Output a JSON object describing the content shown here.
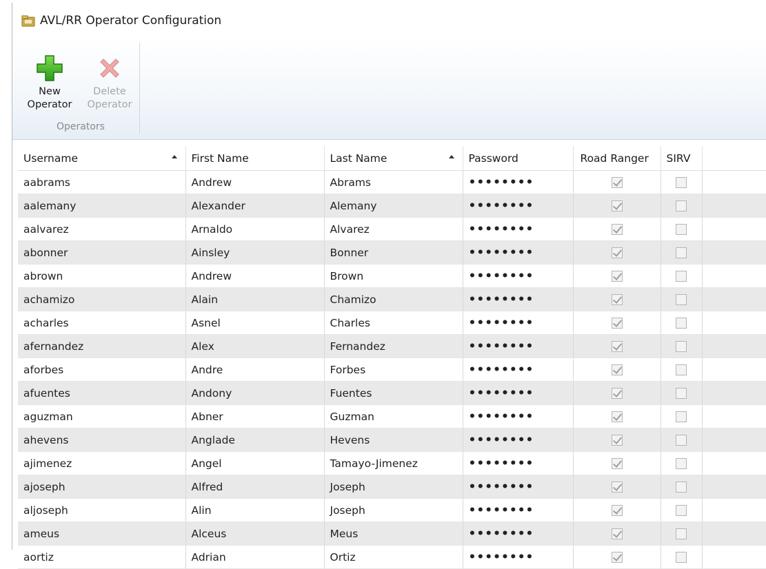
{
  "window": {
    "title": "AVL/RR Operator Configuration",
    "app_icon": "app-folder-icon"
  },
  "ribbon": {
    "new_operator": {
      "line1": "New",
      "line2": "Operator",
      "icon": "plus-icon"
    },
    "delete_operator": {
      "line1": "Delete",
      "line2": "Operator",
      "icon": "delete-x-icon"
    },
    "group_label": "Operators"
  },
  "grid": {
    "columns": [
      "Username",
      "First Name",
      "Last Name",
      "Password",
      "Road Ranger",
      "SIRV"
    ],
    "sorted_columns": [
      "Username",
      "Last Name"
    ],
    "rows": [
      {
        "username": "aabrams",
        "first": "Andrew",
        "last": "Abrams",
        "password": "••••••••",
        "road_ranger": true,
        "sirv": false
      },
      {
        "username": "aalemany",
        "first": "Alexander",
        "last": "Alemany",
        "password": "••••••••",
        "road_ranger": true,
        "sirv": false
      },
      {
        "username": "aalvarez",
        "first": "Arnaldo",
        "last": "Alvarez",
        "password": "••••••••",
        "road_ranger": true,
        "sirv": false
      },
      {
        "username": "abonner",
        "first": "Ainsley",
        "last": "Bonner",
        "password": "••••••••",
        "road_ranger": true,
        "sirv": false
      },
      {
        "username": "abrown",
        "first": "Andrew",
        "last": "Brown",
        "password": "••••••••",
        "road_ranger": true,
        "sirv": false
      },
      {
        "username": "achamizo",
        "first": "Alain",
        "last": "Chamizo",
        "password": "••••••••",
        "road_ranger": true,
        "sirv": false
      },
      {
        "username": "acharles",
        "first": "Asnel",
        "last": "Charles",
        "password": "••••••••",
        "road_ranger": true,
        "sirv": false
      },
      {
        "username": "afernandez",
        "first": "Alex",
        "last": "Fernandez",
        "password": "••••••••",
        "road_ranger": true,
        "sirv": false
      },
      {
        "username": "aforbes",
        "first": "Andre",
        "last": "Forbes",
        "password": "••••••••",
        "road_ranger": true,
        "sirv": false
      },
      {
        "username": "afuentes",
        "first": "Andony",
        "last": "Fuentes",
        "password": "••••••••",
        "road_ranger": true,
        "sirv": false
      },
      {
        "username": "aguzman",
        "first": "Abner",
        "last": "Guzman",
        "password": "••••••••",
        "road_ranger": true,
        "sirv": false
      },
      {
        "username": "ahevens",
        "first": "Anglade",
        "last": "Hevens",
        "password": "••••••••",
        "road_ranger": true,
        "sirv": false
      },
      {
        "username": "ajimenez",
        "first": "Angel",
        "last": "Tamayo-Jimenez",
        "password": "••••••••",
        "road_ranger": true,
        "sirv": false
      },
      {
        "username": "ajoseph",
        "first": "Alfred",
        "last": "Joseph",
        "password": "••••••••",
        "road_ranger": true,
        "sirv": false
      },
      {
        "username": "aljoseph",
        "first": "Alin",
        "last": "Joseph",
        "password": "••••••••",
        "road_ranger": true,
        "sirv": false
      },
      {
        "username": "ameus",
        "first": "Alceus",
        "last": "Meus",
        "password": "••••••••",
        "road_ranger": true,
        "sirv": false
      },
      {
        "username": "aortiz",
        "first": "Adrian",
        "last": "Ortiz",
        "password": "••••••••",
        "road_ranger": true,
        "sirv": false
      }
    ]
  }
}
